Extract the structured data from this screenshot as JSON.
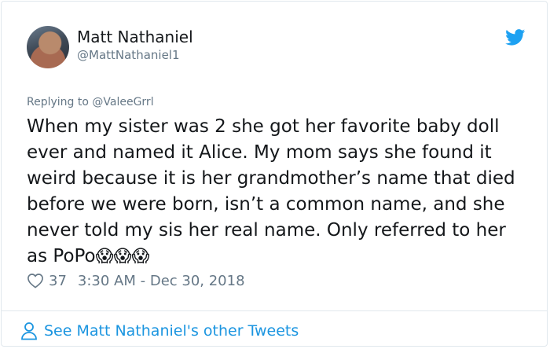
{
  "author": {
    "name": "Matt Nathaniel",
    "handle": "@MattNathaniel1"
  },
  "reply": {
    "prefix": "Replying to ",
    "mention": "@ValeeGrrl"
  },
  "tweet": {
    "text": "When my sister was 2 she got her favorite baby doll ever and named it Alice. My mom says she found it weird because it is her grandmother’s name that died before we were born, isn’t a common name, and she never told my sis her real name. Only referred to her as PoPo",
    "emoji": "😱😱😱"
  },
  "meta": {
    "likes": "37",
    "timestamp": "3:30 AM - Dec 30, 2018"
  },
  "footer": {
    "link_label": "See Matt Nathaniel's other Tweets"
  },
  "icons": {
    "brand": "twitter-bird-icon",
    "like": "heart-icon",
    "profile": "person-icon"
  },
  "colors": {
    "brand_blue": "#1da1f2",
    "link_blue": "#1b95e0",
    "muted": "#657786",
    "text": "#14171a"
  }
}
